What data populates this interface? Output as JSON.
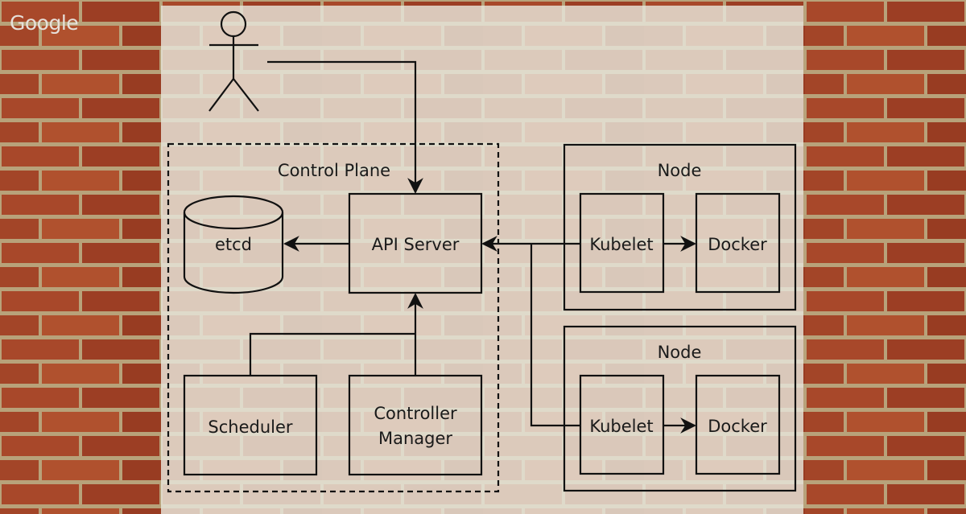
{
  "brand": {
    "logo_text": "Google"
  },
  "colors": {
    "brick": "#a5462a",
    "mortar": "#b8a27a",
    "panel": "#e8e6dc",
    "line": "#111111"
  },
  "diagram": {
    "actor": {
      "icon": "user-stick-figure-icon"
    },
    "control_plane": {
      "label": "Control Plane",
      "etcd": "etcd",
      "api_server": "API Server",
      "scheduler": "Scheduler",
      "controller_manager_line1": "Controller",
      "controller_manager_line2": "Manager"
    },
    "nodes": [
      {
        "label": "Node",
        "kubelet": "Kubelet",
        "docker": "Docker"
      },
      {
        "label": "Node",
        "kubelet": "Kubelet",
        "docker": "Docker"
      }
    ]
  }
}
